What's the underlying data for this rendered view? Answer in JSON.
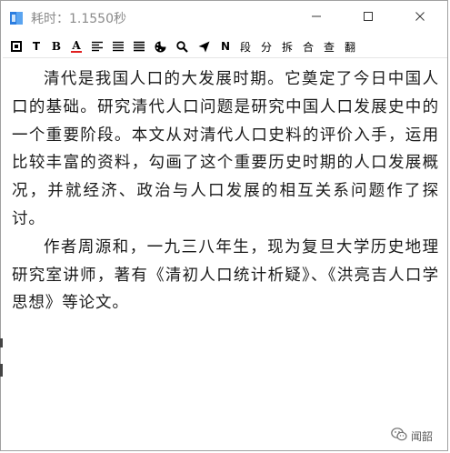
{
  "window": {
    "title": "耗时：1.1550秒"
  },
  "titlebar": {
    "minimize_icon": "minimize-icon",
    "maximize_icon": "maximize-icon",
    "close_icon": "close-icon"
  },
  "toolbar": {
    "items": [
      {
        "name": "stop-icon",
        "label": ""
      },
      {
        "name": "text-t-icon",
        "label": "T"
      },
      {
        "name": "bold-icon",
        "label": "B"
      },
      {
        "name": "font-color-icon",
        "label": "A"
      },
      {
        "name": "align-left-icon",
        "label": ""
      },
      {
        "name": "align-center-icon",
        "label": ""
      },
      {
        "name": "align-justify-icon",
        "label": ""
      },
      {
        "name": "palette-icon",
        "label": ""
      },
      {
        "name": "search-icon",
        "label": ""
      },
      {
        "name": "send-icon",
        "label": ""
      },
      {
        "name": "n-icon",
        "label": "N"
      },
      {
        "name": "paragraph-button",
        "label": "段"
      },
      {
        "name": "split-button",
        "label": "分"
      },
      {
        "name": "break-button",
        "label": "拆"
      },
      {
        "name": "merge-button",
        "label": "合"
      },
      {
        "name": "check-button",
        "label": "查"
      },
      {
        "name": "translate-button",
        "label": "翻"
      }
    ]
  },
  "content": {
    "paragraph1": "清代是我国人口的大发展时期。它奠定了今日中国人口的基础。研究清代人口问题是研究中国人口发展史中的一个重要阶段。本文从对清代人口史料的评价入手，运用比较丰富的资料，勾画了这个重要历史时期的人口发展概况，并就经济、政治与人口发展的相互关系问题作了探讨。",
    "paragraph2": "作者周源和，一九三八年生，现为复旦大学历史地理研究室讲师，著有《清初人口统计析疑》、《洪亮吉人口学思想》等论文。"
  },
  "watermark": {
    "text": "闻韶"
  },
  "colors": {
    "accent": "#2b7de0",
    "title_text": "#8a8a8a",
    "body_text": "#1a1a1a",
    "font_color_underline": "#e02020"
  }
}
